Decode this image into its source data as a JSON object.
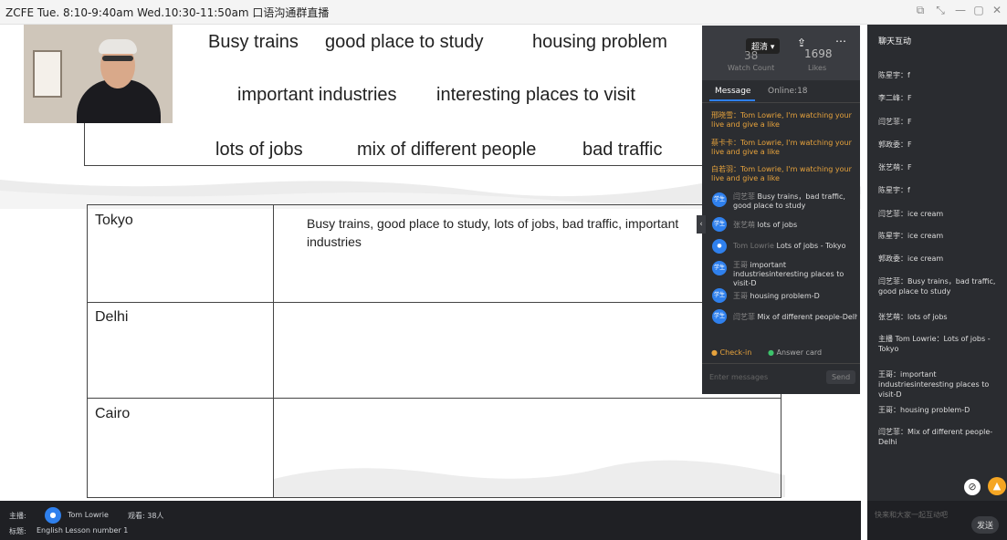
{
  "window": {
    "title": "ZCFE Tue. 8:10-9:40am Wed.10:30-11:50am 口语沟通群直播",
    "controls": [
      "⧉",
      "⤡",
      "—",
      "▢",
      "✕"
    ]
  },
  "slide": {
    "words": [
      "Busy trains",
      "good place to study",
      "housing problem",
      "important industries",
      "interesting places to visit",
      "lots of jobs",
      "mix of different people",
      "bad traffic"
    ],
    "rows": [
      {
        "city": "Tokyo",
        "note": "Busy trains, good place to study, lots of jobs, bad traffic, important industries"
      },
      {
        "city": "Delhi",
        "note": ""
      },
      {
        "city": "Cairo",
        "note": ""
      }
    ]
  },
  "live_panel": {
    "quality_label": "超清 ▾",
    "watch_count": "38",
    "watch_label": "Watch Count",
    "likes_count": "1698",
    "likes_label": "Likes",
    "tab_message": "Message",
    "tab_online": "Online:18",
    "system_msgs": [
      "邢晓雪：Tom Lowrie, I'm watching your live and give a like",
      "蔡卡卡：Tom Lowrie, I'm watching your live and give a like",
      "白若羽：Tom Lowrie, I'm watching your live and give a like"
    ],
    "chat_msgs": [
      {
        "badge": "学生",
        "name": "闫艺菲",
        "text": "Busy trains，bad traffic, good place to study"
      },
      {
        "badge": "学生",
        "name": "张艺萌",
        "text": "lots of jobs"
      },
      {
        "badge": "●",
        "name": "Tom Lowrie",
        "text": "Lots of jobs - Tokyo"
      },
      {
        "badge": "学生",
        "name": "王哥",
        "text": "important industriesinteresting places to visit-D"
      },
      {
        "badge": "学生",
        "name": "王哥",
        "text": "housing problem-D"
      },
      {
        "badge": "学生",
        "name": "闫艺菲",
        "text": "Mix of different people-Delhi"
      }
    ],
    "checkin_label": "Check-in",
    "answer_label": "Answer card",
    "input_placeholder": "Enter messages",
    "send_label": "Send"
  },
  "chat_side": {
    "header": "聊天互动",
    "lines": [
      "陈星宇：f",
      "李二峰：F",
      "闫艺菲：F",
      "郭政委：F",
      "张艺萌：F",
      "陈星宇：f",
      "闫艺菲：ice cream",
      "陈星宇：ice cream",
      "郭政委：ice cream",
      "闫艺菲：Busy trains，bad traffic, good place to study",
      "张艺萌：lots of jobs",
      "主播 Tom Lowrie：Lots of jobs - Tokyo",
      "王哥：important industriesinteresting places to visit-D",
      "王哥：housing problem-D",
      "闫艺菲：Mix of different people-Delhi"
    ],
    "input_placeholder": "快来和大家一起互动吧",
    "send_label": "发送"
  },
  "bottom": {
    "host_label": "主播:",
    "host_name": "Tom Lowrie",
    "viewers": "观看: 38人",
    "title_label": "标题:",
    "title": "English Lesson number 1"
  },
  "colors": {
    "system_msg": "#e6a23c",
    "avatar": "#2f80ed",
    "panel_bg": "#2b2d31"
  }
}
